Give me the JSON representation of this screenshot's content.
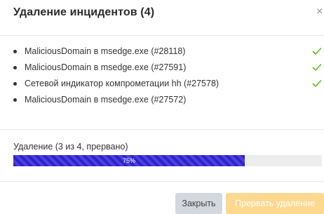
{
  "dialog": {
    "title": "Удаление инцидентов (4)",
    "close_symbol": "×"
  },
  "items": [
    {
      "text": "MaliciousDomain в msedge.exe (#28118)",
      "status": "done",
      "icon": "check-icon"
    },
    {
      "text": "MaliciousDomain в msedge.exe (#27591)",
      "status": "done",
      "icon": "check-icon"
    },
    {
      "text": "Сетевой индикатор компрометации hh (#27578)",
      "status": "done",
      "icon": "check-icon"
    },
    {
      "text": "MaliciousDomain в msedge.exe (#27572)",
      "status": "pending"
    }
  ],
  "progress": {
    "label": "Удаление (3 из 4, прервано)",
    "percent_text": "75%",
    "value": 0.75
  },
  "buttons": {
    "close_label": "Закрыть",
    "abort_label": "Прервать удаление"
  },
  "colors": {
    "progress_fill": "#3a2fd6",
    "check": "#52c41a",
    "abort_button": "#fdd88f",
    "close_button": "#d3d7de"
  }
}
